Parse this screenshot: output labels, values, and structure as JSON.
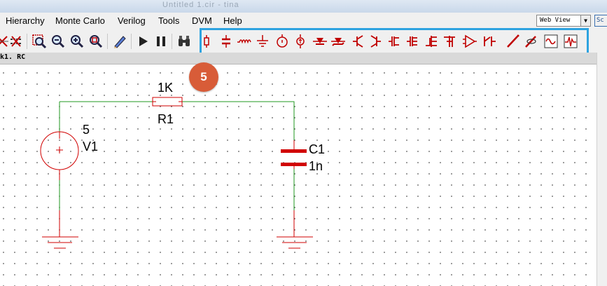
{
  "window": {
    "title": "Untitled 1.cir - tina"
  },
  "menu": {
    "items": [
      "Hierarchy",
      "Monte Carlo",
      "Verilog",
      "Tools",
      "DVM",
      "Help"
    ],
    "view_select": "Web View",
    "view_button": "Sc"
  },
  "document": {
    "tab_label": "k1. RC"
  },
  "circuit": {
    "source": {
      "value": "5",
      "name": "V1"
    },
    "resistor": {
      "value": "1K",
      "name": "R1"
    },
    "capacitor": {
      "name": "C1",
      "value": "1n"
    }
  },
  "callout": {
    "number": "5"
  },
  "colors": {
    "component": "#d10000",
    "wire": "#229922",
    "highlight": "#2ea3e0",
    "callout": "#d85c38"
  }
}
